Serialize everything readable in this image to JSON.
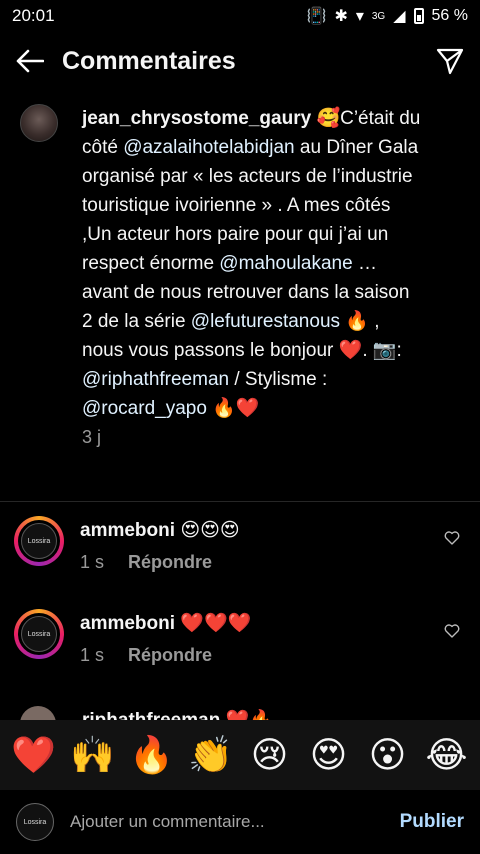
{
  "status": {
    "time": "20:01",
    "network_label": "3G",
    "battery": "56 %"
  },
  "header": {
    "title": "Commentaires",
    "back_icon": "arrow-left-icon",
    "share_icon": "paper-plane-icon"
  },
  "caption": {
    "username": "jean_chrysostome_gaury",
    "lines": [
      "🥰C’était du côté ",
      "@azalaihotelabidjan",
      " au Dîner Gala organisé par « les acteurs de l’industrie touristique ivoirienne » . A mes côtés ,Un acteur hors paire pour qui j’ai un respect énorme ",
      "@mahoulakane",
      " … avant de nous retrouver dans la saison 2 de la série ",
      "@lefuturestanous",
      " 🔥 , nous vous passons le bonjour ❤️. 📷: ",
      "@riphathfreeman",
      " / Stylisme : ",
      "@rocard_yapo",
      " 🔥❤️"
    ],
    "time": "3 j"
  },
  "comments": [
    {
      "username": "ammeboni",
      "text": "😍😍😍",
      "time": "1 s",
      "reply": "Répondre",
      "avatar_label": "Lossira"
    },
    {
      "username": "ammeboni",
      "text": "❤️❤️❤️",
      "time": "1 s",
      "reply": "Répondre",
      "avatar_label": "Lossira"
    }
  ],
  "partial_comment": {
    "username": "riphathfreeman",
    "text": "❤️🔥"
  },
  "emoji_bar": [
    "❤️",
    "🙌",
    "🔥",
    "👏",
    "😢",
    "😍",
    "😮",
    "😂"
  ],
  "composer": {
    "placeholder": "Ajouter un commentaire...",
    "publish": "Publier",
    "avatar_label": "Lossira"
  }
}
